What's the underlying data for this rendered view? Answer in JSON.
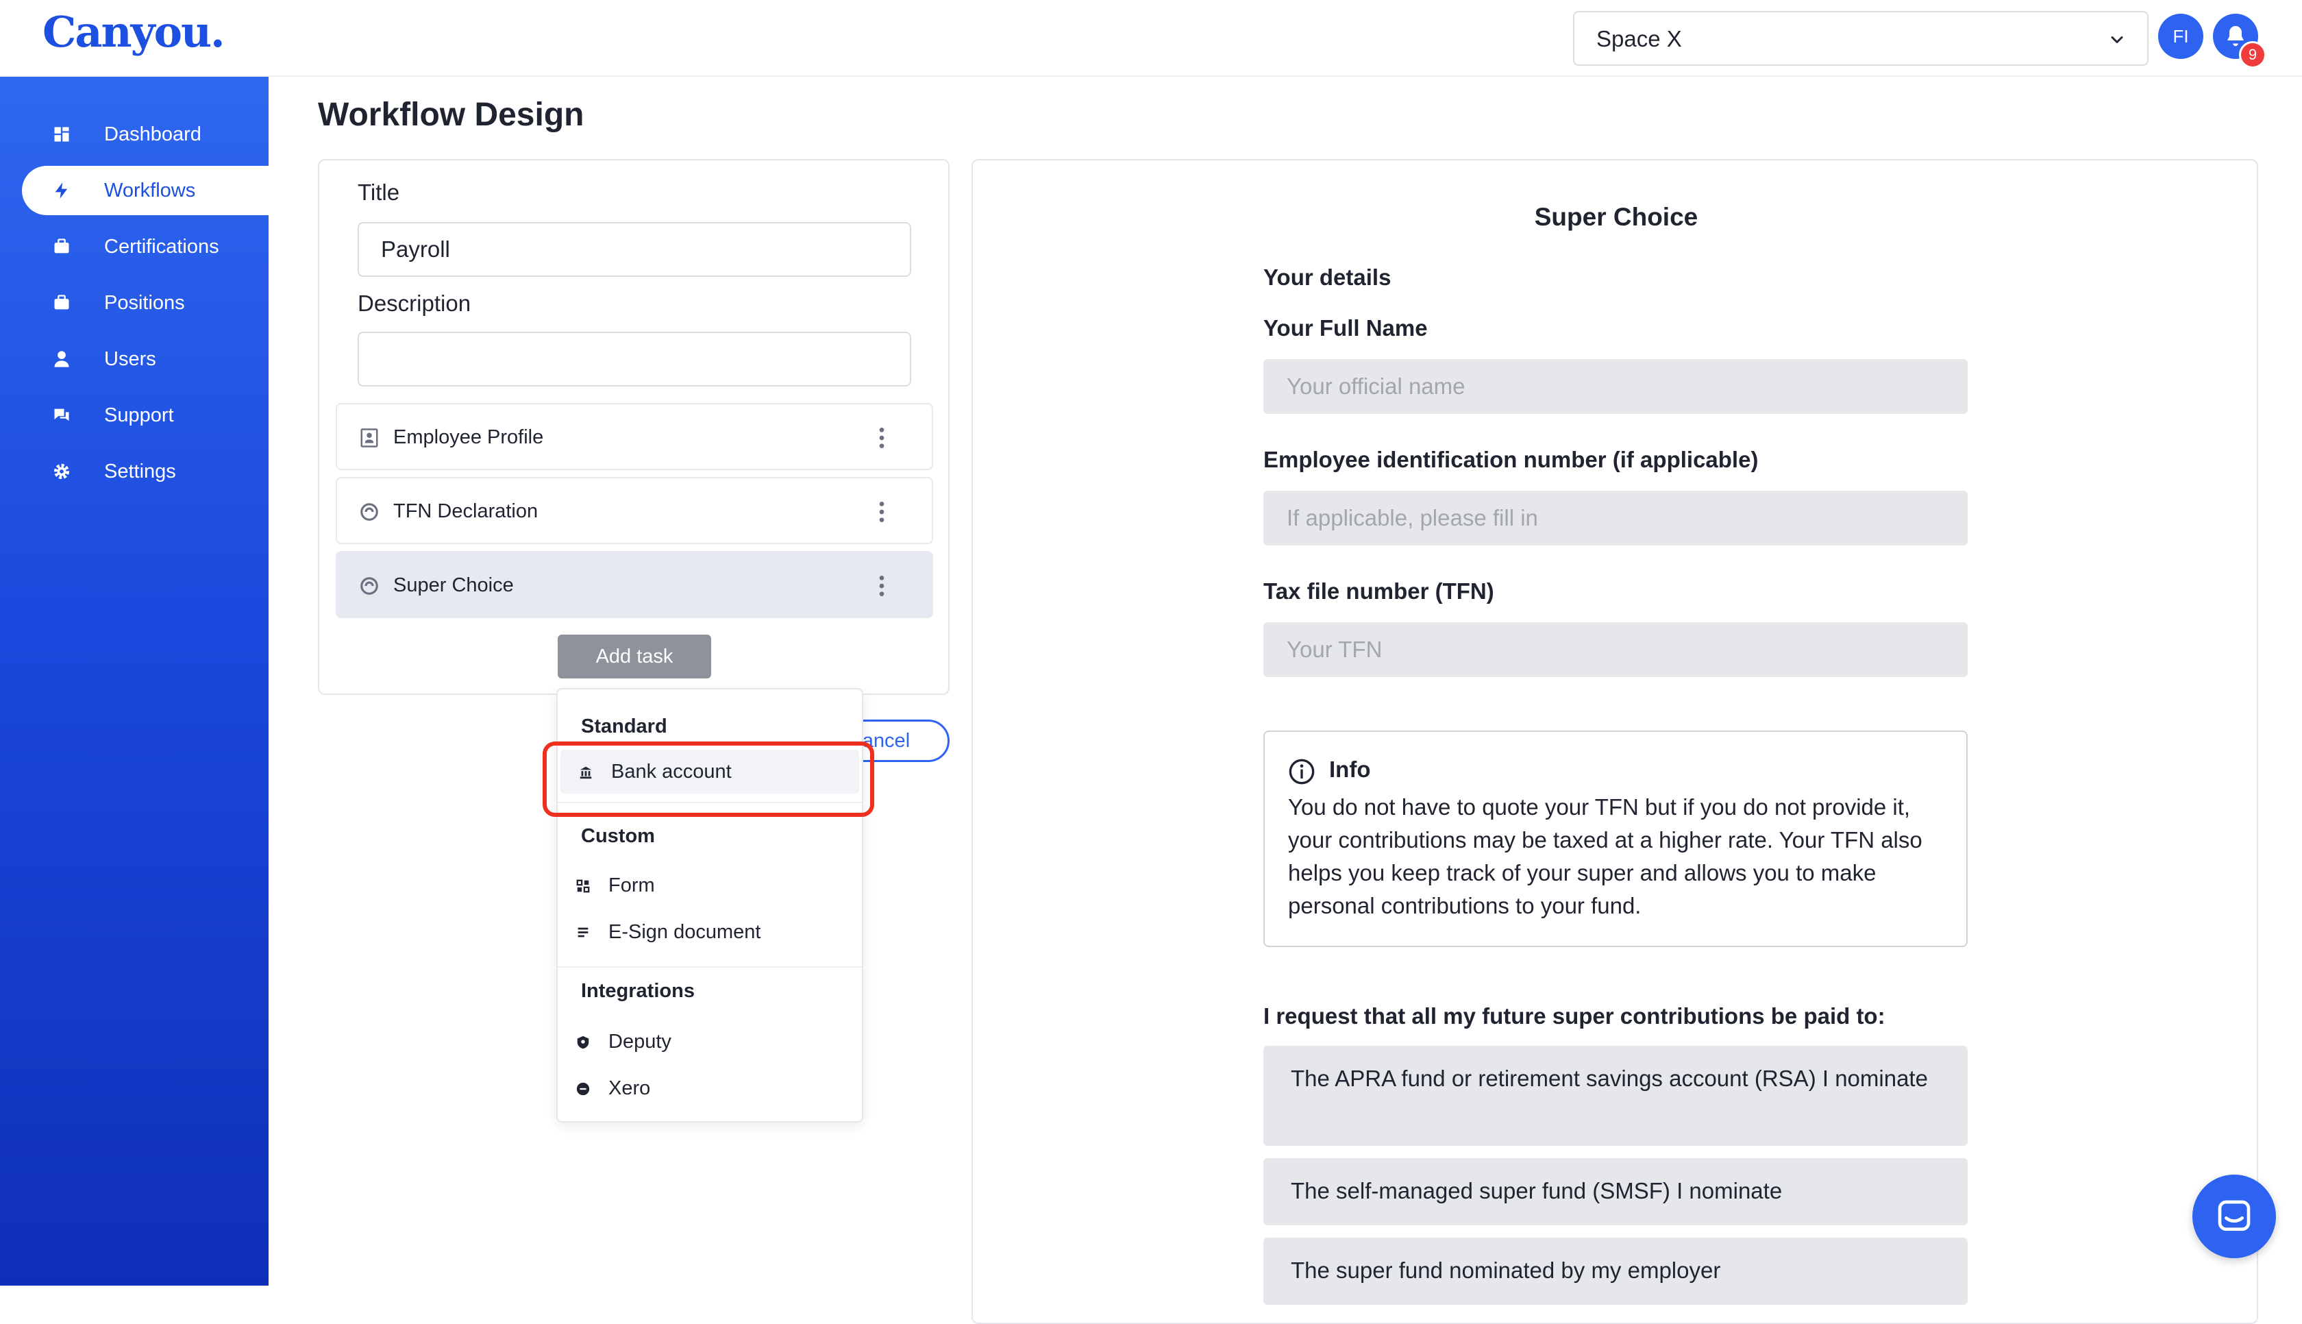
{
  "header": {
    "logo": "Canyou.",
    "space_select": "Space X",
    "avatar_initials": "FI",
    "notification_count": "9"
  },
  "sidebar": {
    "items": [
      {
        "label": "Dashboard",
        "icon": "dashboard-icon"
      },
      {
        "label": "Workflows",
        "icon": "lightning-icon",
        "active": true
      },
      {
        "label": "Certifications",
        "icon": "briefcase-icon"
      },
      {
        "label": "Positions",
        "icon": "briefcase-icon"
      },
      {
        "label": "Users",
        "icon": "user-icon"
      },
      {
        "label": "Support",
        "icon": "support-icon"
      },
      {
        "label": "Settings",
        "icon": "gear-icon"
      }
    ]
  },
  "page": {
    "title": "Workflow Design"
  },
  "form": {
    "title_label": "Title",
    "title_value": "Payroll",
    "description_label": "Description",
    "description_value": ""
  },
  "tasks": [
    {
      "label": "Employee Profile",
      "icon": "profile-icon"
    },
    {
      "label": "TFN Declaration",
      "icon": "link-icon"
    },
    {
      "label": "Super Choice",
      "icon": "link-icon",
      "selected": true
    }
  ],
  "buttons": {
    "add_task": "Add task",
    "cancel": "Cancel"
  },
  "dropdown": {
    "standard_header": "Standard",
    "standard_items": [
      {
        "label": "Bank account",
        "icon": "bank-icon"
      }
    ],
    "custom_header": "Custom",
    "custom_items": [
      {
        "label": "Form",
        "icon": "form-icon"
      },
      {
        "label": "E-Sign document",
        "icon": "document-icon"
      }
    ],
    "integrations_header": "Integrations",
    "integration_items": [
      {
        "label": "Deputy",
        "icon": "deputy-icon"
      },
      {
        "label": "Xero",
        "icon": "xero-icon"
      }
    ]
  },
  "preview": {
    "title": "Super Choice",
    "your_details": "Your details",
    "full_name_label": "Your Full Name",
    "full_name_placeholder": "Your official name",
    "employee_id_label": "Employee identification number (if applicable)",
    "employee_id_placeholder": "If applicable, please fill in",
    "tfn_label": "Tax file number (TFN)",
    "tfn_placeholder": "Your TFN",
    "info_title": "Info",
    "info_text": "You do not have to quote your TFN but if you do not provide it, your contributions may be taxed at a higher rate. Your TFN also helps you keep track of your super and allows you to make personal contributions to your fund.",
    "request_label": "I request that all my future super contributions be paid to:",
    "options": [
      "The APRA fund or retirement savings account (RSA) I nominate",
      "The self-managed super fund (SMSF) I nominate",
      "The super fund nominated by my employer"
    ]
  },
  "colors": {
    "brand": "#1d4fe0",
    "highlight": "#f0301e",
    "badge": "#ef3b3b"
  }
}
